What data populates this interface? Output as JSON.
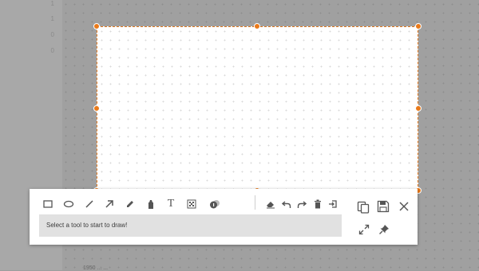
{
  "background": {
    "line_numbers": [
      "1",
      "1",
      "0",
      "0"
    ],
    "bottom_fragment": "1950 ... ..."
  },
  "colors": {
    "accent": "#ea7a1a",
    "icon": "#555555",
    "status_bg": "#e1e1e1"
  },
  "toolbar": {
    "tools": [
      {
        "name": "rectangle-tool",
        "icon": "rectangle-icon"
      },
      {
        "name": "ellipse-tool",
        "icon": "ellipse-icon"
      },
      {
        "name": "line-tool",
        "icon": "line-icon"
      },
      {
        "name": "arrow-tool",
        "icon": "arrow-icon"
      },
      {
        "name": "pen-tool",
        "icon": "pencil-icon"
      },
      {
        "name": "highlighter-tool",
        "icon": "marker-icon"
      },
      {
        "name": "text-tool",
        "icon": "text-icon",
        "glyph": "T"
      },
      {
        "name": "blur-tool",
        "icon": "mosaic-icon"
      },
      {
        "name": "counter-tool",
        "icon": "counter-icon"
      }
    ],
    "actions": [
      {
        "name": "eraser-button",
        "icon": "eraser-icon"
      },
      {
        "name": "undo-button",
        "icon": "undo-icon"
      },
      {
        "name": "redo-button",
        "icon": "redo-icon"
      },
      {
        "name": "clear-button",
        "icon": "trash-icon"
      },
      {
        "name": "exit-button",
        "icon": "exit-icon"
      }
    ],
    "status_text": "Select a tool to start to draw!",
    "side_buttons": [
      {
        "name": "copy-button",
        "icon": "copy-icon"
      },
      {
        "name": "save-button",
        "icon": "save-icon"
      },
      {
        "name": "close-button",
        "icon": "close-icon"
      },
      {
        "name": "expand-button",
        "icon": "expand-icon"
      },
      {
        "name": "pin-button",
        "icon": "pin-icon"
      }
    ]
  }
}
